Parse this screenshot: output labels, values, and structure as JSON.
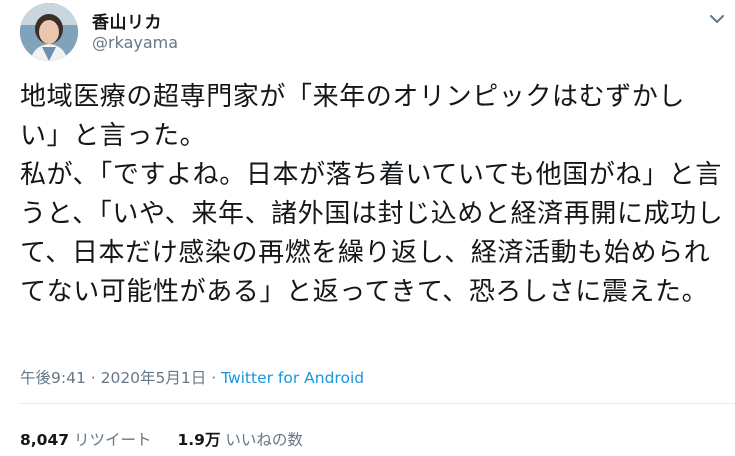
{
  "author": {
    "display_name": "香山リカ",
    "handle": "@rkayama"
  },
  "tweet": {
    "text": "地域医療の超専門家が「来年のオリンピックはむずかしい」と言った。\n私が、「ですよね。日本が落ち着いていても他国がね」と言うと、「いや、来年、諸外国は封じ込めと経済再開に成功して、日本だけ感染の再燃を繰り返し、経済活動も始められてない可能性がある」と返ってきて、恐ろしさに震えた。",
    "time": "午後9:41",
    "separator": " · ",
    "date": "2020年5月1日",
    "source": "Twitter for Android"
  },
  "stats": {
    "retweets_count": "8,047",
    "retweets_label": "リツイート",
    "likes_count": "1.9万",
    "likes_label": "いいねの数"
  },
  "icons": {
    "menu": "chevron-down-icon",
    "avatar": "avatar"
  },
  "colors": {
    "text": "#14171a",
    "secondary": "#657786",
    "link": "#1b95e0"
  }
}
